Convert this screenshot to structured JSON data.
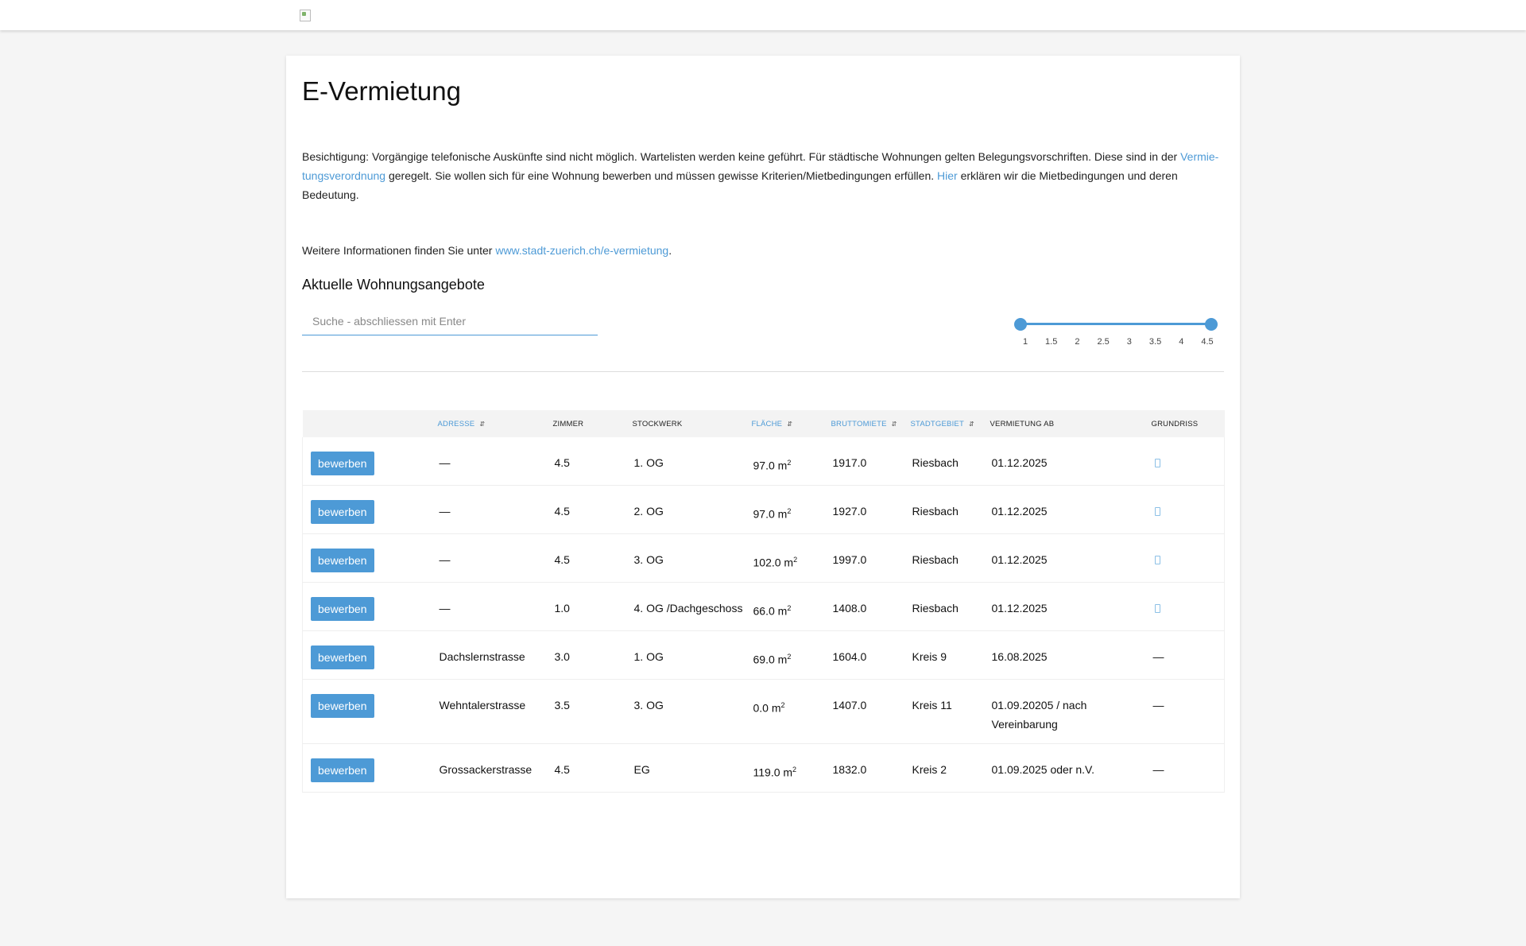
{
  "header": {
    "logo": "logo"
  },
  "page": {
    "title": "E-Vermietung",
    "intro": {
      "part1": "Besichtigung: Vorgängige telefonische Auskünfte sind nicht möglich. Wartelisten werden keine geführt. Für städtische Wohnungen gelten Belegungsvorschriften. Diese sind in der ",
      "link1": "Vermie­tungsverordnung",
      "part2": " geregelt. Sie wollen sich für eine Wohnung bewerben und müssen gewisse Kriterien/Mietbedingungen erfüllen. ",
      "link2": "Hier",
      "part3": " erklären wir die Mietbedingungen und deren Bedeutung."
    },
    "more_info": {
      "text": "Weitere Informationen finden Sie unter ",
      "link": "www.stadt-zuerich.ch/e-vermietung",
      "suffix": "."
    },
    "section_title": "Aktuelle Wohnungsangebote"
  },
  "search": {
    "placeholder": "Suche - abschliessen mit Enter",
    "value": ""
  },
  "room_filter": {
    "min": 1,
    "max": 4.5,
    "selected": [
      1,
      4.5
    ],
    "ticks": [
      "1",
      "1.5",
      "2",
      "2.5",
      "3",
      "3.5",
      "4",
      "4.5"
    ]
  },
  "table": {
    "columns": [
      {
        "label": "",
        "sortable": false
      },
      {
        "label": "Adresse",
        "sortable": true
      },
      {
        "label": "Zimmer",
        "sortable": false
      },
      {
        "label": "Stockwerk",
        "sortable": false
      },
      {
        "label": "Fläche",
        "sortable": true
      },
      {
        "label": "Bruttomiete",
        "sortable": true
      },
      {
        "label": "Stadtgebiet",
        "sortable": true
      },
      {
        "label": "Vermietung ab",
        "sortable": false
      },
      {
        "label": "Grundriss",
        "sortable": false
      }
    ],
    "apply_label": "bewerben",
    "area_unit": "m",
    "area_exp": "2",
    "rows": [
      {
        "adresse": "—",
        "zimmer": "4.5",
        "stockwerk": "1. OG",
        "flaeche": "97.0",
        "miete": "1917.0",
        "gebiet": "Riesbach",
        "ab": "01.12.2025",
        "grundriss": "icon"
      },
      {
        "adresse": "—",
        "zimmer": "4.5",
        "stockwerk": "2. OG",
        "flaeche": "97.0",
        "miete": "1927.0",
        "gebiet": "Riesbach",
        "ab": "01.12.2025",
        "grundriss": "icon"
      },
      {
        "adresse": "—",
        "zimmer": "4.5",
        "stockwerk": "3. OG",
        "flaeche": "102.0",
        "miete": "1997.0",
        "gebiet": "Riesbach",
        "ab": "01.12.2025",
        "grundriss": "icon"
      },
      {
        "adresse": "—",
        "zimmer": "1.0",
        "stockwerk": "4. OG /Dachgeschoss",
        "flaeche": "66.0",
        "miete": "1408.0",
        "gebiet": "Riesbach",
        "ab": "01.12.2025",
        "grundriss": "icon"
      },
      {
        "adresse": "Dachslernstrasse",
        "zimmer": "3.0",
        "stockwerk": "1. OG",
        "flaeche": "69.0",
        "miete": "1604.0",
        "gebiet": "Kreis 9",
        "ab": "16.08.2025",
        "grundriss": "—"
      },
      {
        "adresse": "Wehntalerstrasse",
        "zimmer": "3.5",
        "stockwerk": "3. OG",
        "flaeche": "0.0",
        "miete": "1407.0",
        "gebiet": "Kreis 11",
        "ab": "01.09.20205 / nach Vereinbarung",
        "grundriss": "—"
      },
      {
        "adresse": "Grossackerstrasse",
        "zimmer": "4.5",
        "stockwerk": "EG",
        "flaeche": "119.0",
        "miete": "1832.0",
        "gebiet": "Kreis 2",
        "ab": "01.09.2025 oder n.V.",
        "grundriss": "—"
      }
    ]
  }
}
